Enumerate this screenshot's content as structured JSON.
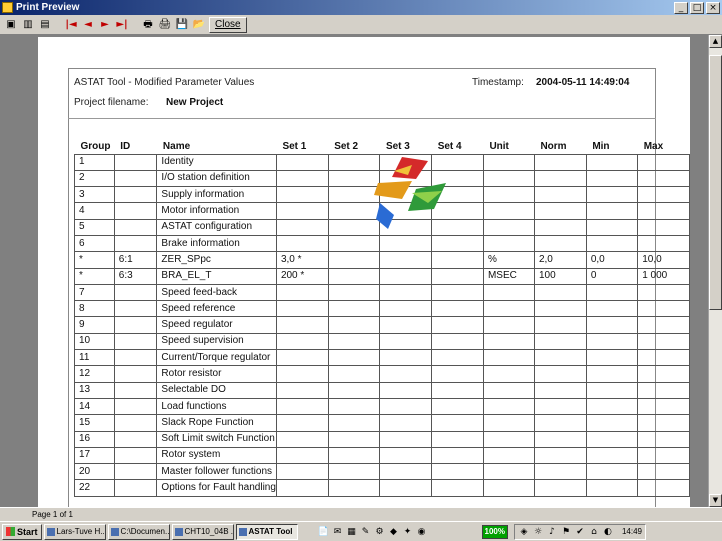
{
  "window": {
    "title": "Print Preview",
    "controls": [
      "_",
      "□",
      "×"
    ]
  },
  "toolbar": {
    "icons": [
      "page-icon",
      "two-pages-icon",
      "fit-icon"
    ],
    "nav": [
      "|◄",
      "◄",
      "►",
      "►|"
    ],
    "tools": [
      "🖶",
      "🖨",
      "💾",
      "📂"
    ],
    "close_label": "Close"
  },
  "report": {
    "title": "ASTAT Tool - Modified Parameter Values",
    "timestamp_label": "Timestamp:",
    "timestamp_value": "2004-05-11 14:49:04",
    "project_label": "Project filename:",
    "project_value": "New Project",
    "columns": [
      "Group",
      "ID",
      "Name",
      "Set 1",
      "Set 2",
      "Set 3",
      "Set 4",
      "Unit",
      "Norm",
      "Min",
      "Max"
    ],
    "rows": [
      [
        "1",
        "",
        "Identity",
        "",
        "",
        "",
        "",
        "",
        "",
        "",
        ""
      ],
      [
        "2",
        "",
        "I/O station definition",
        "",
        "",
        "",
        "",
        "",
        "",
        "",
        ""
      ],
      [
        "3",
        "",
        "Supply information",
        "",
        "",
        "",
        "",
        "",
        "",
        "",
        ""
      ],
      [
        "4",
        "",
        "Motor information",
        "",
        "",
        "",
        "",
        "",
        "",
        "",
        ""
      ],
      [
        "5",
        "",
        "ASTAT configuration",
        "",
        "",
        "",
        "",
        "",
        "",
        "",
        ""
      ],
      [
        "6",
        "",
        "Brake information",
        "",
        "",
        "",
        "",
        "",
        "",
        "",
        ""
      ],
      [
        "*",
        "6:1",
        "ZER_SPpc",
        "3,0 *",
        "",
        "",
        "",
        "%",
        "2,0",
        "0,0",
        "10,0"
      ],
      [
        "*",
        "6:3",
        "BRA_EL_T",
        "200 *",
        "",
        "",
        "",
        "MSEC",
        "100",
        "0",
        "1 000"
      ],
      [
        "7",
        "",
        "Speed feed-back",
        "",
        "",
        "",
        "",
        "",
        "",
        "",
        ""
      ],
      [
        "8",
        "",
        "Speed reference",
        "",
        "",
        "",
        "",
        "",
        "",
        "",
        ""
      ],
      [
        "9",
        "",
        "Speed regulator",
        "",
        "",
        "",
        "",
        "",
        "",
        "",
        ""
      ],
      [
        "10",
        "",
        "Speed supervision",
        "",
        "",
        "",
        "",
        "",
        "",
        "",
        ""
      ],
      [
        "11",
        "",
        "Current/Torque regulator",
        "",
        "",
        "",
        "",
        "",
        "",
        "",
        ""
      ],
      [
        "12",
        "",
        "Rotor resistor",
        "",
        "",
        "",
        "",
        "",
        "",
        "",
        ""
      ],
      [
        "13",
        "",
        "Selectable DO",
        "",
        "",
        "",
        "",
        "",
        "",
        "",
        ""
      ],
      [
        "14",
        "",
        "Load functions",
        "",
        "",
        "",
        "",
        "",
        "",
        "",
        ""
      ],
      [
        "15",
        "",
        "Slack Rope Function",
        "",
        "",
        "",
        "",
        "",
        "",
        "",
        ""
      ],
      [
        "16",
        "",
        "Soft Limit switch Function",
        "",
        "",
        "",
        "",
        "",
        "",
        "",
        ""
      ],
      [
        "17",
        "",
        "Rotor system",
        "",
        "",
        "",
        "",
        "",
        "",
        "",
        ""
      ],
      [
        "20",
        "",
        "Master follower functions",
        "",
        "",
        "",
        "",
        "",
        "",
        "",
        ""
      ],
      [
        "22",
        "",
        "Options for Fault handling",
        "",
        "",
        "",
        "",
        "",
        "",
        "",
        ""
      ]
    ]
  },
  "status": {
    "page": "Page 1 of 1"
  },
  "taskbar": {
    "start_label": "Start",
    "tasks": [
      {
        "label": "Lars-Tuve H...",
        "active": false
      },
      {
        "label": "C:\\Documen...",
        "active": false
      },
      {
        "label": "CHT10_04B ...",
        "active": false
      },
      {
        "label": "ASTAT Tool",
        "active": true
      }
    ],
    "quicklaunch": [
      "📄",
      "✉",
      "▦",
      "✎",
      "⚙",
      "◆",
      "✦",
      "◉"
    ],
    "zoom": "100%",
    "tray_icons": [
      "◈",
      "☼",
      "♪",
      "⚑",
      "✔",
      "⌂",
      "◐"
    ],
    "clock": "14:49"
  }
}
